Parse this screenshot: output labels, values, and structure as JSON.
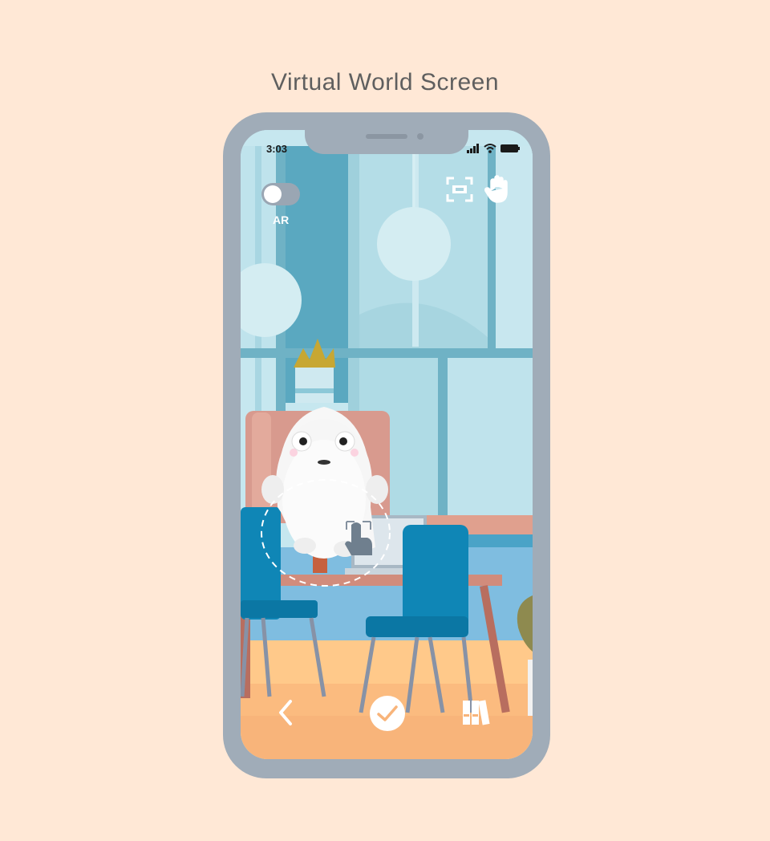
{
  "page": {
    "title": "Virtual World Screen"
  },
  "status_bar": {
    "time": "3:03"
  },
  "top_controls": {
    "ar_toggle": {
      "label": "AR",
      "on": false
    },
    "icons": [
      "scan-frame-icon",
      "hand-icon"
    ]
  },
  "bottom_bar": {
    "icons": [
      "back-chevron-icon",
      "confirm-check-icon",
      "library-books-icon"
    ]
  },
  "colors": {
    "background": "#ffe8d6",
    "phone_frame": "#a0acb8",
    "chair_blue": "#0f86b6",
    "floor": "#f8b77c"
  }
}
